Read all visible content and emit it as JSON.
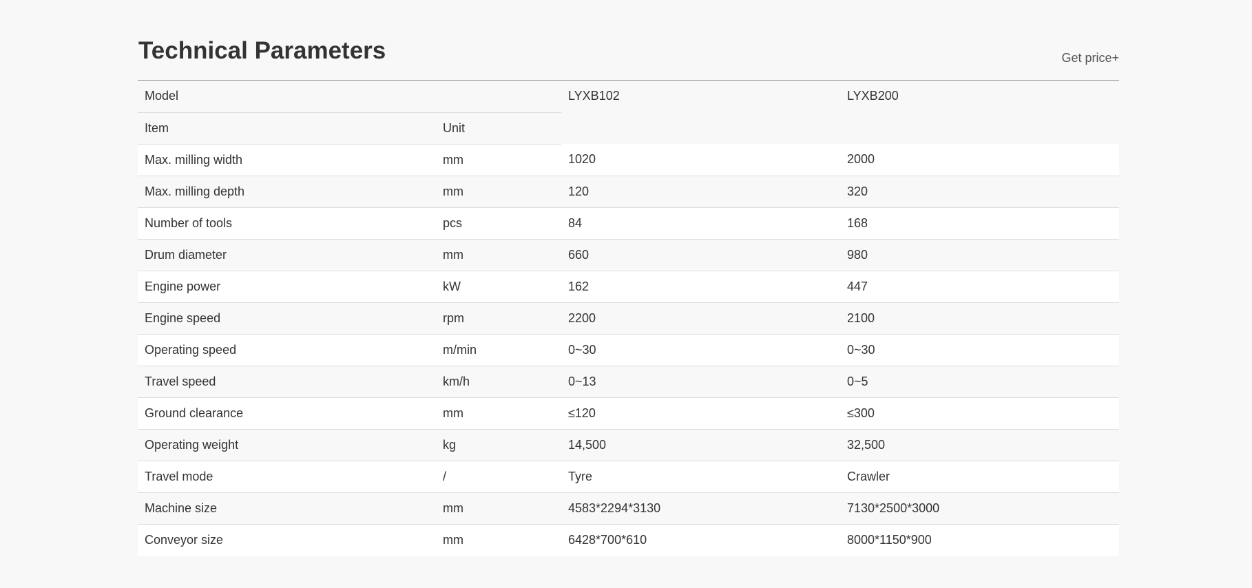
{
  "page": {
    "title": "Technical Parameters",
    "get_price_label": "Get price+"
  },
  "table": {
    "model_label": "Model",
    "models": [
      "LYXB102",
      "LYXB200"
    ],
    "item_label": "Item",
    "unit_label": "Unit",
    "rows": [
      {
        "item": "Max. milling width",
        "unit": "mm",
        "v1": "1020",
        "v2": "2000"
      },
      {
        "item": "Max. milling depth",
        "unit": "mm",
        "v1": "120",
        "v2": "320"
      },
      {
        "item": "Number of tools",
        "unit": "pcs",
        "v1": "84",
        "v2": "168"
      },
      {
        "item": "Drum diameter",
        "unit": "mm",
        "v1": "660",
        "v2": "980"
      },
      {
        "item": "Engine power",
        "unit": "kW",
        "v1": "162",
        "v2": "447"
      },
      {
        "item": "Engine speed",
        "unit": "rpm",
        "v1": "2200",
        "v2": "2100"
      },
      {
        "item": "Operating speed",
        "unit": "m/min",
        "v1": "0~30",
        "v2": "0~30"
      },
      {
        "item": "Travel speed",
        "unit": "km/h",
        "v1": "0~13",
        "v2": "0~5"
      },
      {
        "item": "Ground clearance",
        "unit": "mm",
        "v1": "≤120",
        "v2": "≤300"
      },
      {
        "item": "Operating weight",
        "unit": "kg",
        "v1": "14,500",
        "v2": "32,500"
      },
      {
        "item": "Travel mode",
        "unit": "/",
        "v1": "Tyre",
        "v2": "Crawler"
      },
      {
        "item": "Machine size",
        "unit": "mm",
        "v1": "4583*2294*3130",
        "v2": "7130*2500*3000"
      },
      {
        "item": "Conveyor size",
        "unit": "mm",
        "v1": "6428*700*610",
        "v2": "8000*1150*900"
      }
    ]
  }
}
